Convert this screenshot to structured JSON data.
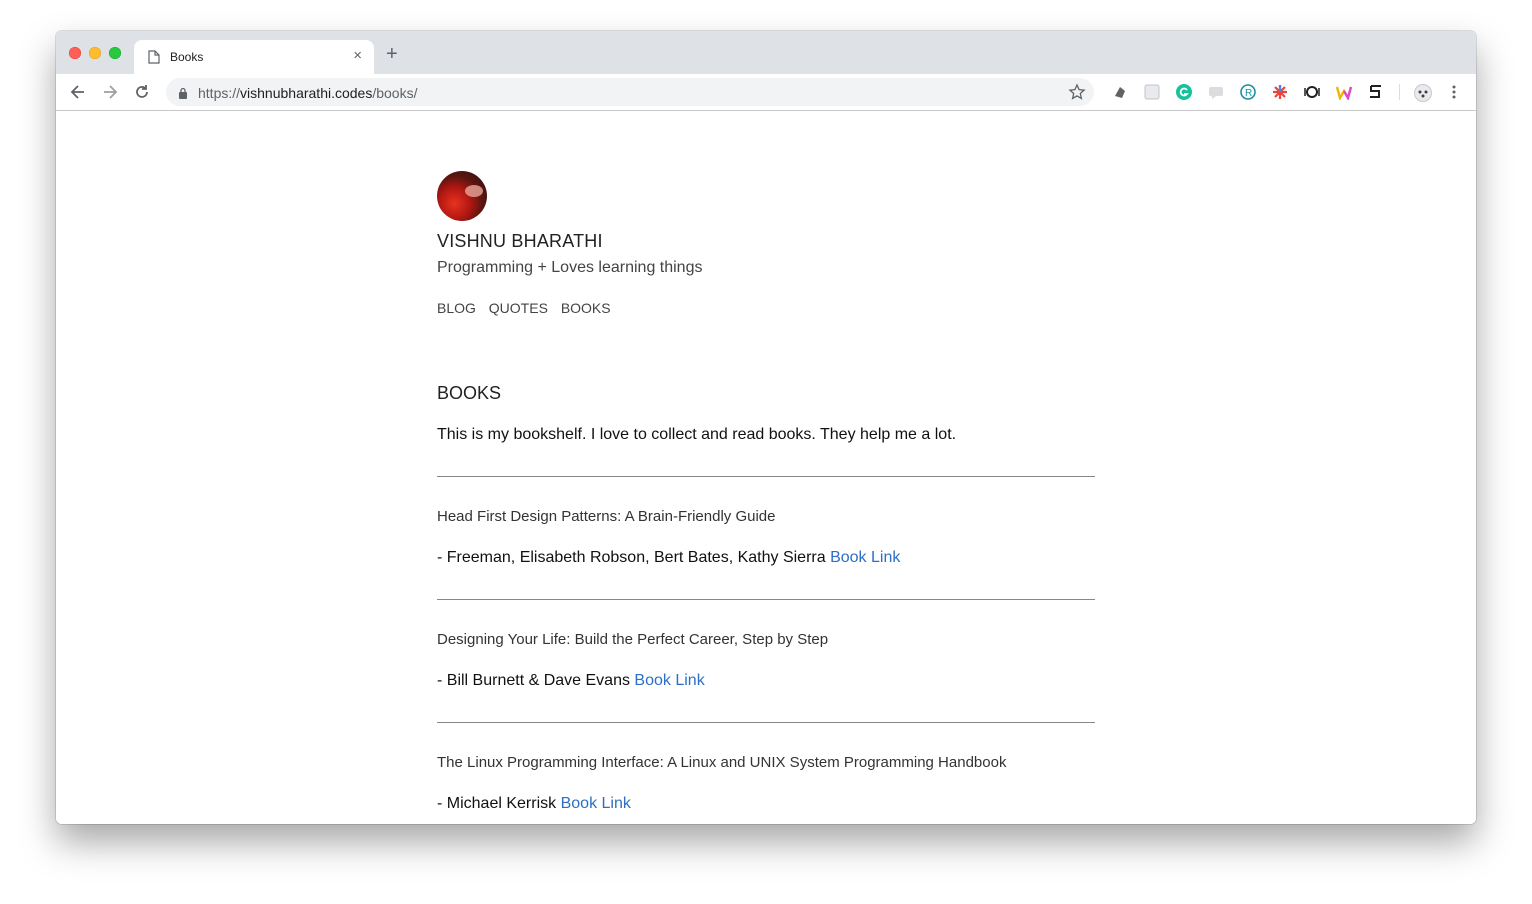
{
  "browser": {
    "tab_title": "Books",
    "tab_close": "×",
    "new_tab": "+",
    "url_scheme": "https://",
    "url_host": "vishnubharathi.codes",
    "url_path": "/books/"
  },
  "site": {
    "name": "VISHNU BHARATHI",
    "description": "Programming + Loves learning things",
    "nav": [
      "BLOG",
      "QUOTES",
      "BOOKS"
    ]
  },
  "page": {
    "title": "BOOKS",
    "intro": "This is my bookshelf. I love to collect and read books. They help me a lot.",
    "books": [
      {
        "title": "Head First Design Patterns: A Brain-Friendly Guide",
        "authors": "- Freeman, Elisabeth Robson, Bert Bates, Kathy Sierra",
        "link": "Book Link"
      },
      {
        "title": "Designing Your Life: Build the Perfect Career, Step by Step",
        "authors": "- Bill Burnett & Dave Evans",
        "link": "Book Link"
      },
      {
        "title": "The Linux Programming Interface: A Linux and UNIX System Programming Handbook",
        "authors": "- Michael Kerrisk",
        "link": "Book Link"
      }
    ]
  },
  "colors": {
    "link": "#2d6fc4",
    "tabstrip": "#dee1e6"
  },
  "icons": {
    "toolbar": [
      "back-arrow-icon",
      "forward-arrow-icon",
      "reload-icon",
      "lock-icon",
      "bookmark-star-icon",
      "menu-dots-icon"
    ],
    "extensions": [
      "extension-1-icon",
      "extension-2-icon",
      "grammarly-icon",
      "extension-4-icon",
      "extension-5-icon",
      "extension-6-icon",
      "extension-7-icon",
      "extension-8-icon",
      "extension-9-icon",
      "profile-icon"
    ]
  }
}
